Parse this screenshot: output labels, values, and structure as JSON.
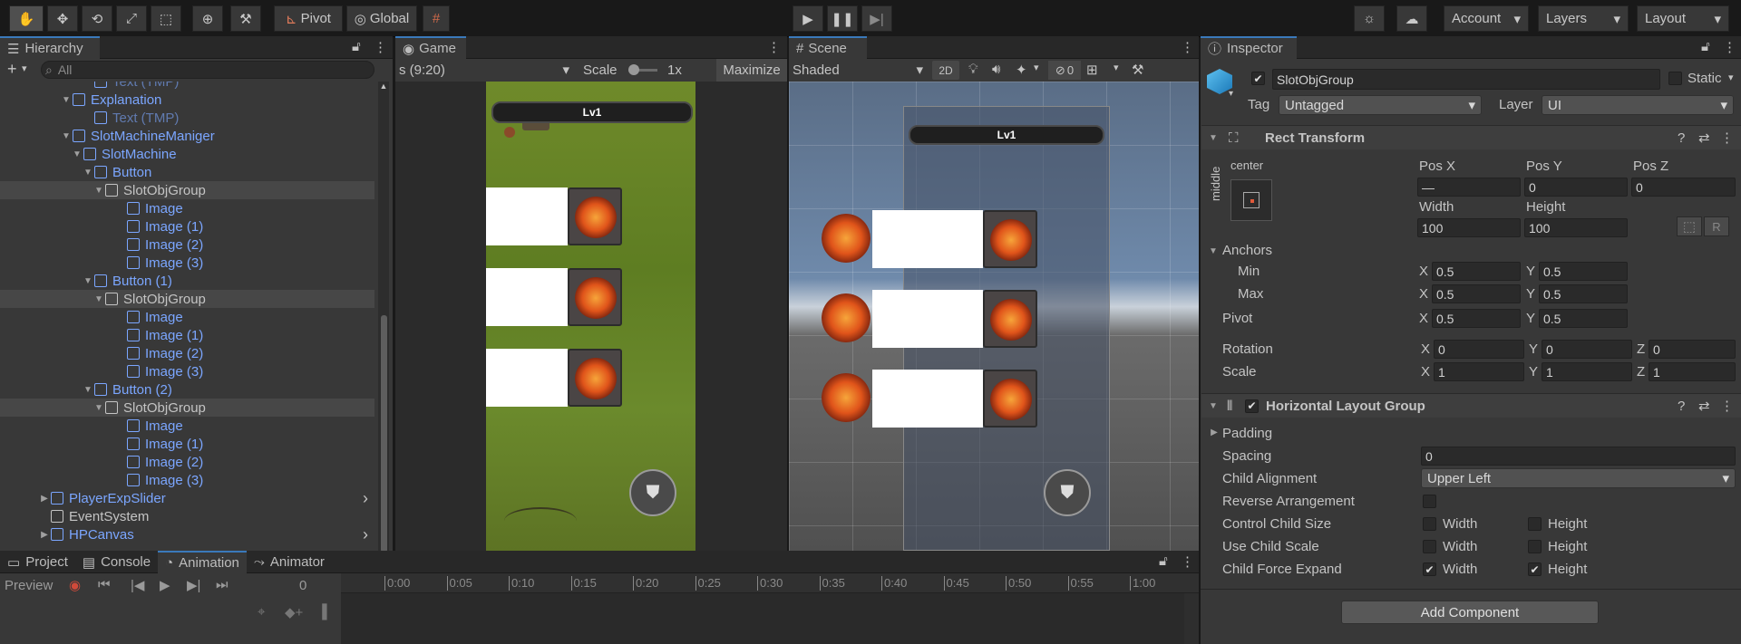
{
  "toolbar": {
    "pivot": "Pivot",
    "global": "Global",
    "account": "Account",
    "layers": "Layers",
    "layout": "Layout"
  },
  "hierarchy": {
    "tab": "Hierarchy",
    "search_placeholder": "All",
    "rows": [
      {
        "label": "Text (TMP)",
        "indent": 8,
        "blue": true,
        "fold": "",
        "sel": false
      },
      {
        "label": "Explanation",
        "indent": 6,
        "blue": true,
        "fold": "▼",
        "sel": false
      },
      {
        "label": "Text (TMP)",
        "indent": 8,
        "blue": true,
        "fold": "",
        "sel": false
      },
      {
        "label": "SlotMachineManiger",
        "indent": 6,
        "blue": true,
        "fold": "▼",
        "sel": false
      },
      {
        "label": "SlotMachine",
        "indent": 7,
        "blue": true,
        "fold": "▼",
        "sel": false
      },
      {
        "label": "Button",
        "indent": 8,
        "blue": true,
        "fold": "▼",
        "sel": false
      },
      {
        "label": "SlotObjGroup",
        "indent": 9,
        "blue": false,
        "fold": "▼",
        "sel": true
      },
      {
        "label": "Image",
        "indent": 11,
        "blue": true,
        "fold": "",
        "sel": false
      },
      {
        "label": "Image (1)",
        "indent": 11,
        "blue": true,
        "fold": "",
        "sel": false
      },
      {
        "label": "Image (2)",
        "indent": 11,
        "blue": true,
        "fold": "",
        "sel": false
      },
      {
        "label": "Image (3)",
        "indent": 11,
        "blue": true,
        "fold": "",
        "sel": false
      },
      {
        "label": "Button (1)",
        "indent": 8,
        "blue": true,
        "fold": "▼",
        "sel": false
      },
      {
        "label": "SlotObjGroup",
        "indent": 9,
        "blue": false,
        "fold": "▼",
        "sel": true
      },
      {
        "label": "Image",
        "indent": 11,
        "blue": true,
        "fold": "",
        "sel": false
      },
      {
        "label": "Image (1)",
        "indent": 11,
        "blue": true,
        "fold": "",
        "sel": false
      },
      {
        "label": "Image (2)",
        "indent": 11,
        "blue": true,
        "fold": "",
        "sel": false
      },
      {
        "label": "Image (3)",
        "indent": 11,
        "blue": true,
        "fold": "",
        "sel": false
      },
      {
        "label": "Button (2)",
        "indent": 8,
        "blue": true,
        "fold": "▼",
        "sel": false
      },
      {
        "label": "SlotObjGroup",
        "indent": 9,
        "blue": false,
        "fold": "▼",
        "sel": true
      },
      {
        "label": "Image",
        "indent": 11,
        "blue": true,
        "fold": "",
        "sel": false
      },
      {
        "label": "Image (1)",
        "indent": 11,
        "blue": true,
        "fold": "",
        "sel": false
      },
      {
        "label": "Image (2)",
        "indent": 11,
        "blue": true,
        "fold": "",
        "sel": false
      },
      {
        "label": "Image (3)",
        "indent": 11,
        "blue": true,
        "fold": "",
        "sel": false
      },
      {
        "label": "PlayerExpSlider",
        "indent": 4,
        "blue": true,
        "fold": "▶",
        "sel": false
      },
      {
        "label": "EventSystem",
        "indent": 4,
        "blue": false,
        "fold": "",
        "sel": false
      },
      {
        "label": "HPCanvas",
        "indent": 4,
        "blue": true,
        "fold": "▶",
        "sel": false
      }
    ]
  },
  "game": {
    "tab": "Game",
    "resolution": "s (9:20)",
    "scale_label": "Scale",
    "scale_value": "1x",
    "maximize": "Maximize",
    "level_text": "Lv1"
  },
  "scene": {
    "tab": "Scene",
    "shading": "Shaded",
    "mode_2d": "2D",
    "hidden_count": "0",
    "level_text": "Lv1"
  },
  "inspector": {
    "tab": "Inspector",
    "object_name": "SlotObjGroup",
    "static": "Static",
    "tag_label": "Tag",
    "tag_value": "Untagged",
    "layer_label": "Layer",
    "layer_value": "UI",
    "rect_transform": "Rect Transform",
    "anchor_h": "center",
    "anchor_v": "middle",
    "posx_label": "Pos X",
    "posy_label": "Pos Y",
    "posz_label": "Pos Z",
    "posx": "—",
    "posy": "0",
    "posz": "0",
    "width_label": "Width",
    "height_label": "Height",
    "width": "100",
    "height": "100",
    "r_button": "R",
    "anchors": "Anchors",
    "min": "Min",
    "max": "Max",
    "pivot": "Pivot",
    "rotation": "Rotation",
    "scale": "Scale",
    "x": "X",
    "y": "Y",
    "z": "Z",
    "anchor_min_x": "0.5",
    "anchor_min_y": "0.5",
    "anchor_max_x": "0.5",
    "anchor_max_y": "0.5",
    "pivot_x": "0.5",
    "pivot_y": "0.5",
    "rot_x": "0",
    "rot_y": "0",
    "rot_z": "0",
    "scale_x": "1",
    "scale_y": "1",
    "scale_z": "1",
    "hlg": "Horizontal Layout Group",
    "padding": "Padding",
    "spacing_label": "Spacing",
    "spacing": "0",
    "child_alignment_label": "Child Alignment",
    "child_alignment": "Upper Left",
    "reverse": "Reverse Arrangement",
    "control_child_size": "Control Child Size",
    "use_child_scale": "Use Child Scale",
    "child_force_expand": "Child Force Expand",
    "w": "Width",
    "h": "Height",
    "add_component": "Add Component"
  },
  "bottom": {
    "tabs": [
      "Project",
      "Console",
      "Animation",
      "Animator"
    ],
    "preview": "Preview",
    "frame": "0",
    "timeline": [
      "0:00",
      "0:05",
      "0:10",
      "0:15",
      "0:20",
      "0:25",
      "0:30",
      "0:35",
      "0:40",
      "0:45",
      "0:50",
      "0:55",
      "1:00"
    ]
  }
}
